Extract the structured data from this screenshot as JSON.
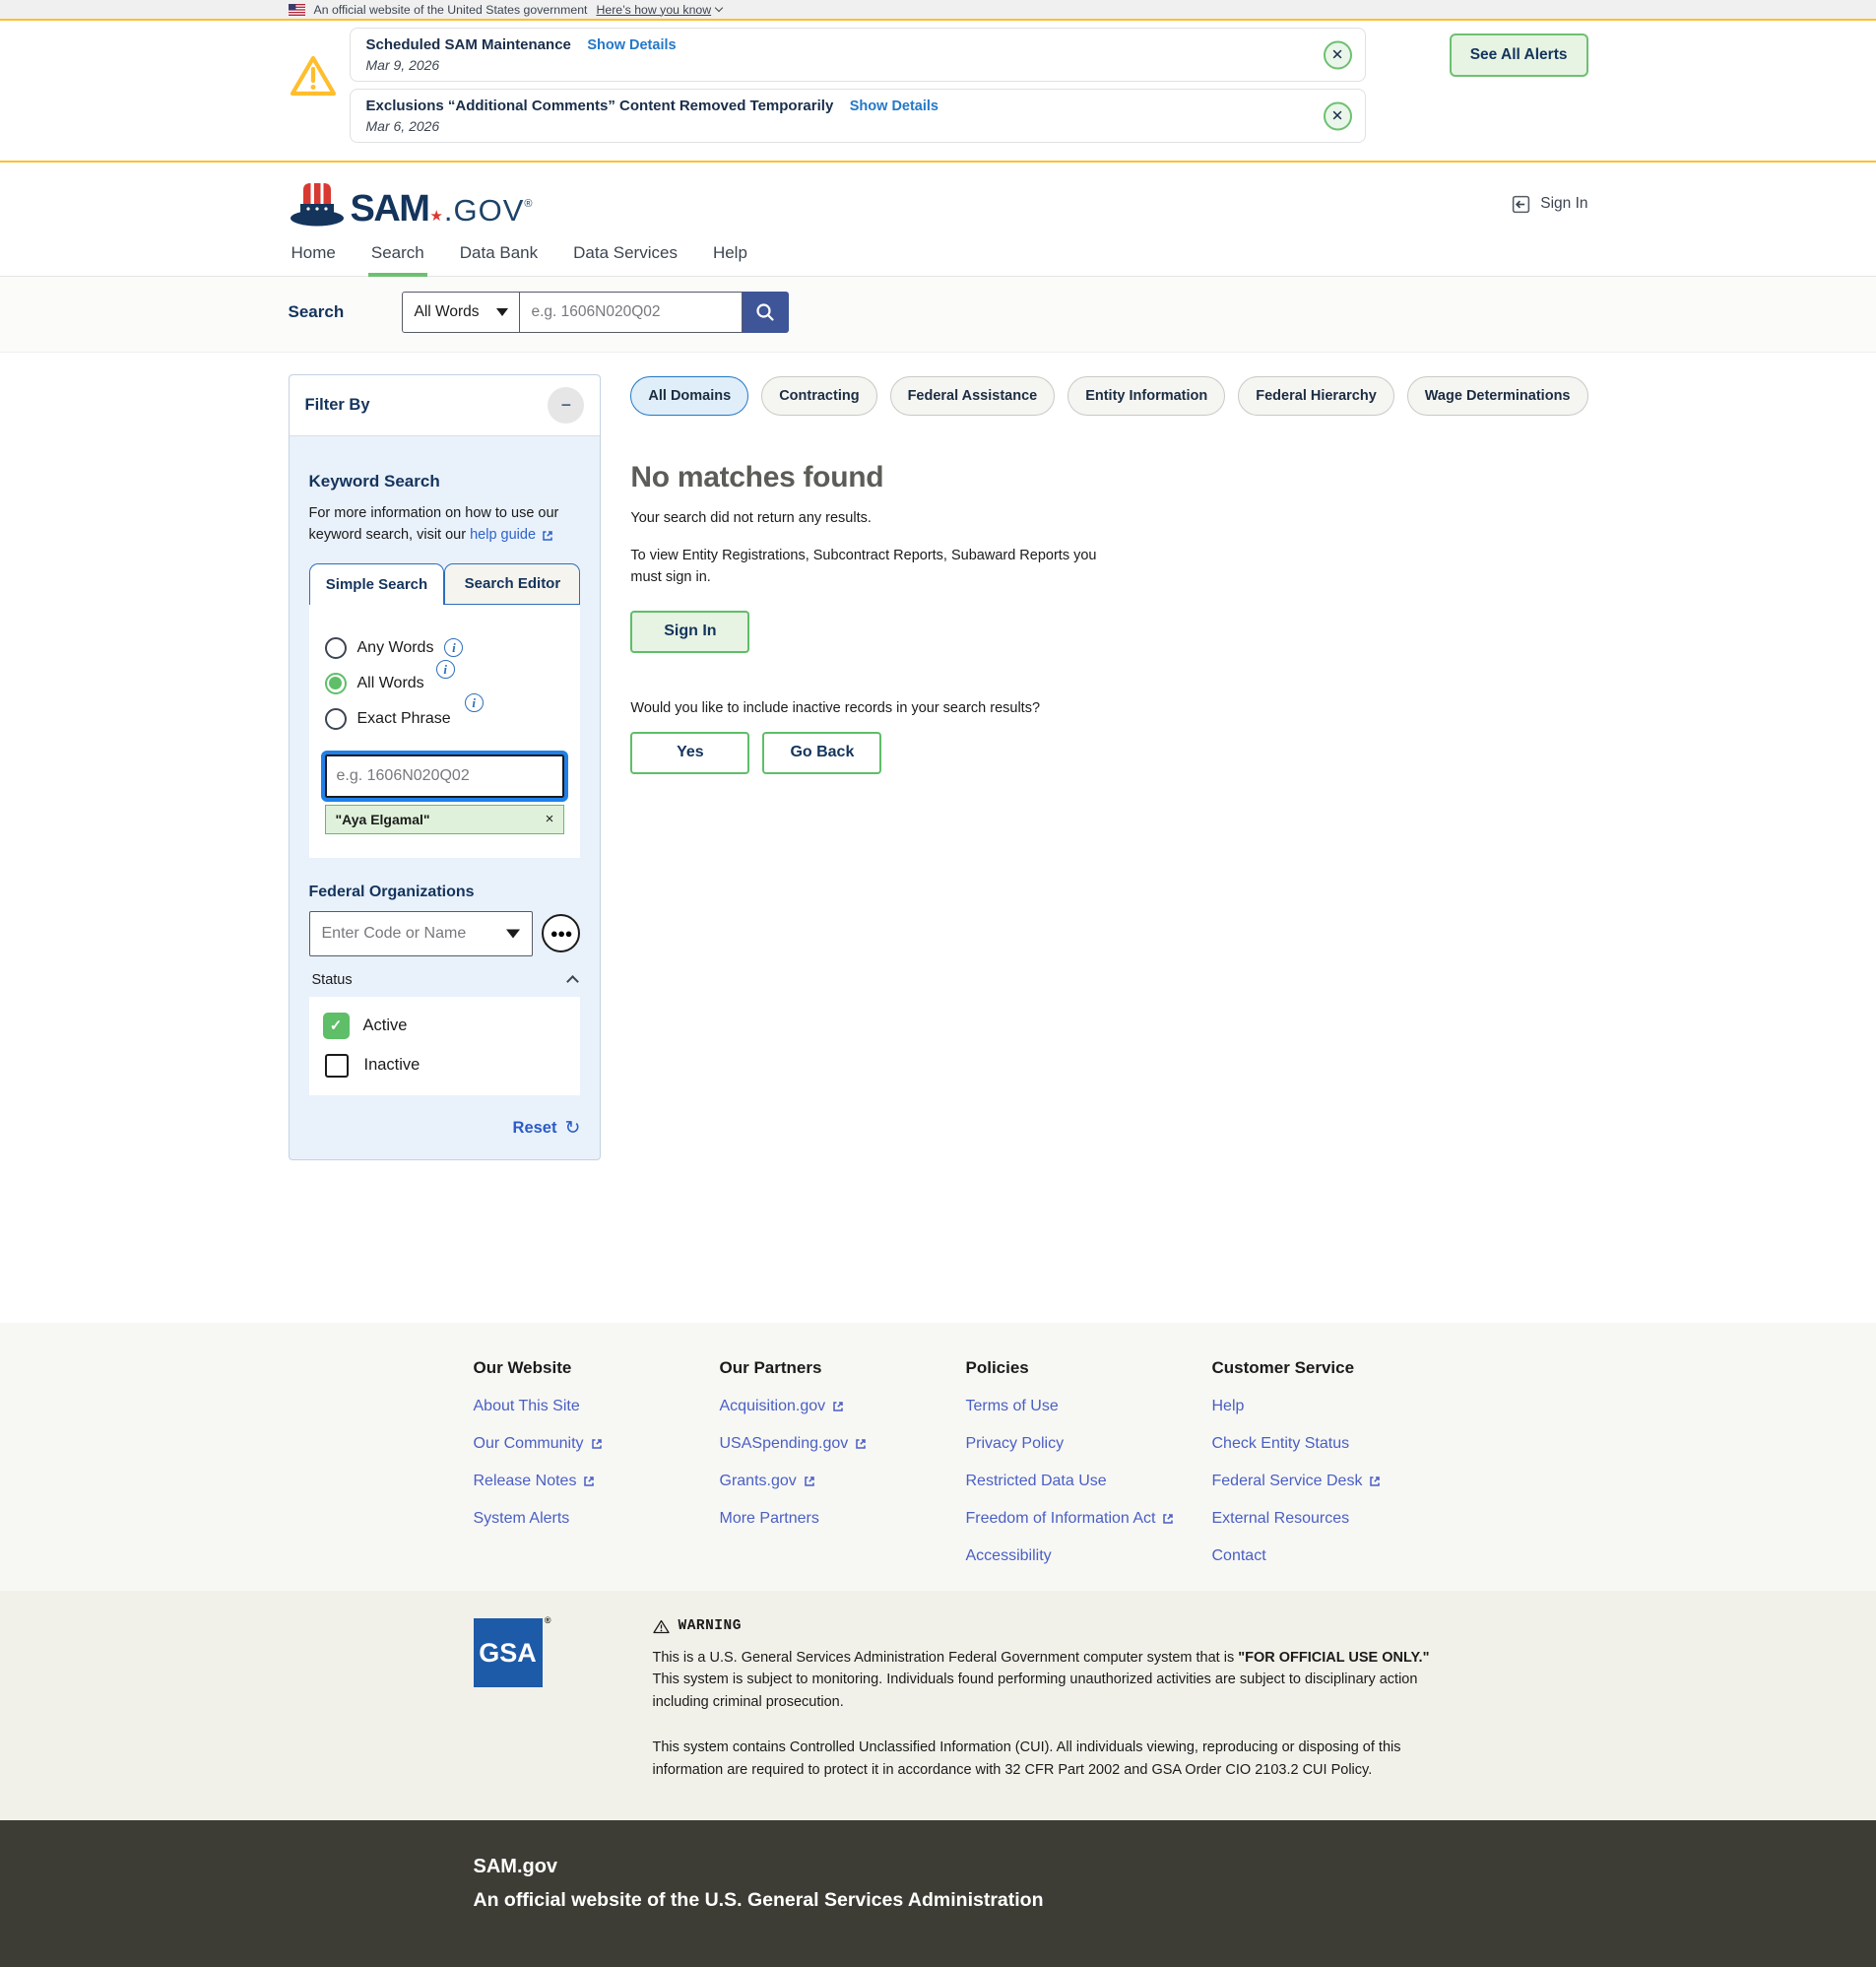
{
  "banner": {
    "text": "An official website of the United States government",
    "link": "Here’s how you know"
  },
  "alerts": {
    "items": [
      {
        "title": "Scheduled SAM Maintenance",
        "link": "Show Details",
        "date": "Mar 9, 2026"
      },
      {
        "title": "Exclusions “Additional Comments” Content Removed Temporarily",
        "link": "Show Details",
        "date": "Mar 6, 2026"
      }
    ],
    "see_all": "See All Alerts"
  },
  "header": {
    "logo_sam": "SAM",
    "logo_gov": ".GOV",
    "sign_in": "Sign In",
    "nav": [
      "Home",
      "Search",
      "Data Bank",
      "Data Services",
      "Help"
    ]
  },
  "search_bar": {
    "label": "Search",
    "mode": "All Words",
    "placeholder": "e.g. 1606N020Q02"
  },
  "filter": {
    "title": "Filter By",
    "keyword": {
      "heading": "Keyword Search",
      "info": "For more information on how to use our keyword search, visit our",
      "help_link": "help guide",
      "tab_simple": "Simple Search",
      "tab_editor": "Search Editor",
      "option_any": "Any Words",
      "option_all": "All Words",
      "option_exact": "Exact Phrase",
      "selected_option": "All Words",
      "placeholder": "e.g. 1606N020Q02",
      "chip": "\"Aya Elgamal\""
    },
    "orgs": {
      "heading": "Federal Organizations",
      "placeholder": "Enter Code or Name"
    },
    "status": {
      "label": "Status",
      "active": "Active",
      "inactive": "Inactive",
      "active_checked": true,
      "inactive_checked": false
    },
    "reset": "Reset"
  },
  "results": {
    "domains": [
      "All Domains",
      "Contracting",
      "Federal Assistance",
      "Entity Information",
      "Federal Hierarchy",
      "Wage Determinations"
    ],
    "active_domain": "All Domains",
    "heading": "No matches found",
    "msg1": "Your search did not return any results.",
    "msg2": "To view Entity Registrations, Subcontract Reports, Subaward Reports you must sign in.",
    "sign_in": "Sign In",
    "question": "Would you like to include inactive records in your search results?",
    "yes": "Yes",
    "go_back": "Go Back"
  },
  "footer": {
    "columns": [
      {
        "heading": "Our Website",
        "links": [
          {
            "label": "About This Site",
            "external": false
          },
          {
            "label": "Our Community",
            "external": true
          },
          {
            "label": "Release Notes",
            "external": true
          },
          {
            "label": "System Alerts",
            "external": false
          }
        ]
      },
      {
        "heading": "Our Partners",
        "links": [
          {
            "label": "Acquisition.gov",
            "external": true
          },
          {
            "label": "USASpending.gov",
            "external": true
          },
          {
            "label": "Grants.gov",
            "external": true
          },
          {
            "label": "More Partners",
            "external": false
          }
        ]
      },
      {
        "heading": "Policies",
        "links": [
          {
            "label": "Terms of Use",
            "external": false
          },
          {
            "label": "Privacy Policy",
            "external": false
          },
          {
            "label": "Restricted Data Use",
            "external": false
          },
          {
            "label": "Freedom of Information Act",
            "external": true
          },
          {
            "label": "Accessibility",
            "external": false
          }
        ]
      },
      {
        "heading": "Customer Service",
        "links": [
          {
            "label": "Help",
            "external": false
          },
          {
            "label": "Check Entity Status",
            "external": false
          },
          {
            "label": "Federal Service Desk",
            "external": true
          },
          {
            "label": "External Resources",
            "external": false
          },
          {
            "label": "Contact",
            "external": false
          }
        ]
      }
    ],
    "gsa_logo": "GSA",
    "warning": {
      "title": "WARNING",
      "p1a": "This is a U.S. General Services Administration Federal Government computer system that is ",
      "p1b": "\"FOR OFFICIAL USE ONLY.\"",
      "p1c": " This system is subject to monitoring. Individuals found performing unauthorized activities are subject to disciplinary action including criminal prosecution.",
      "p2": "This system contains Controlled Unclassified Information (CUI). All individuals viewing, reproducing or disposing of this information are required to protect it in accordance with 32 CFR Part 2002 and GSA Order CIO 2103.2 CUI Policy."
    },
    "bottom_title": "SAM.gov",
    "bottom_subtitle": "An official website of the U.S. General Services Administration"
  },
  "colors": {
    "accent_green": "#6ec071",
    "alert_gold": "#ffbe2e",
    "link_blue": "#2478c8",
    "footer_link_blue": "#4a5fc4",
    "primary_navy": "#14345c",
    "search_button_blue": "#3e5597",
    "focus_ring_blue": "#2080e8",
    "gsa_blue": "#1d5aa8",
    "dark_footer": "#3d3d35"
  }
}
